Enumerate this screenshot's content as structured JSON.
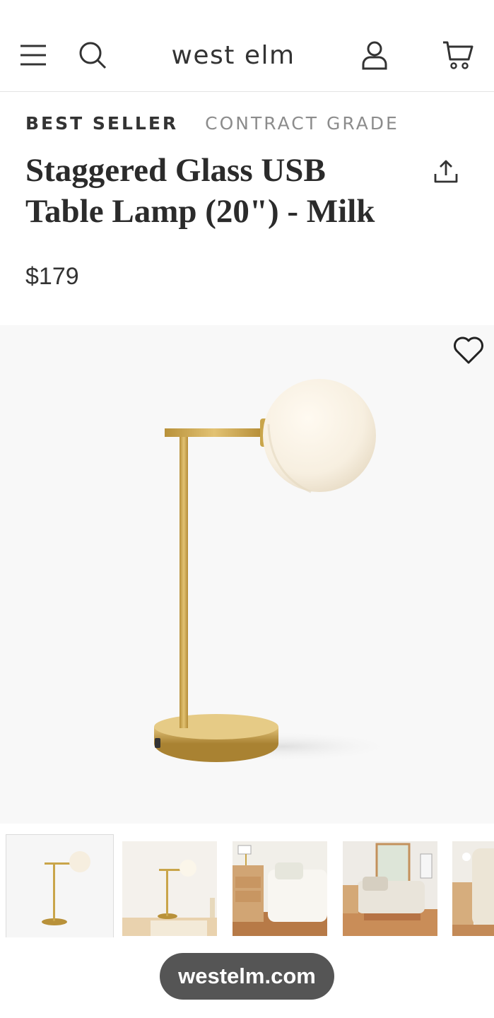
{
  "header": {
    "logo": "west elm",
    "menu_icon": "hamburger-menu-icon",
    "search_icon": "search-icon",
    "account_icon": "user-account-icon",
    "cart_icon": "shopping-cart-icon"
  },
  "product": {
    "tags": [
      "BEST SELLER",
      "CONTRACT GRADE"
    ],
    "title_line1": "Staggered Glass USB",
    "title_line2": "Table Lamp (20\") - Milk",
    "price": "$179",
    "share_icon": "share-upload-icon",
    "favorite_icon": "heart-icon"
  },
  "gallery": {
    "selected_index": 0,
    "thumbnails": [
      "lamp-product-thumbnail",
      "lamp-on-desk-thumbnail",
      "bedroom-nightstand-thumbnail",
      "bedroom-room-thumbnail",
      "bedroom-partial-thumbnail"
    ]
  },
  "browser": {
    "url": "westelm.com"
  },
  "colors": {
    "text_primary": "#2b2b2b",
    "text_secondary": "#8c8c8c",
    "brass": "#c9a54a",
    "pill_bg": "#555555"
  }
}
